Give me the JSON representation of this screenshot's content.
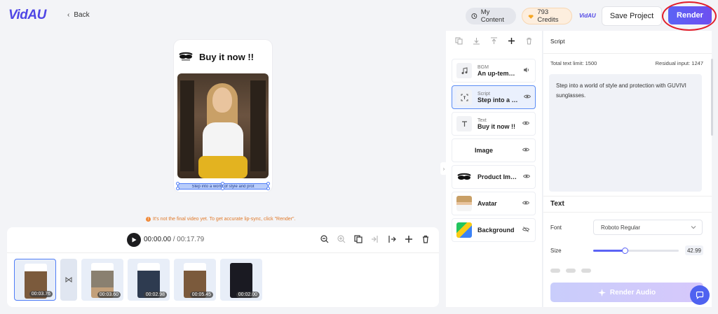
{
  "header": {
    "logo": "VidAU",
    "back_label": "Back",
    "my_content_label": "My Content",
    "credits_label": "793 Credits",
    "brand_small": "VidAU",
    "save_label": "Save Project",
    "render_label": "Render"
  },
  "preview": {
    "title": "Buy it now !!",
    "caption": "Step into a world of style and prot",
    "notice": "It's not the final video yet. To get accurate lip-sync, click \"Render\"."
  },
  "timeline": {
    "current_time": "00:00.00",
    "total_time": "/ 00:17.79",
    "clips": [
      {
        "duration": "00:03.76",
        "selected": true
      },
      {
        "duration": "00:03.60",
        "selected": false
      },
      {
        "duration": "00:02.98",
        "selected": false
      },
      {
        "duration": "00:05.45",
        "selected": false
      },
      {
        "duration": "00:02.00",
        "selected": false
      }
    ]
  },
  "layers": {
    "items": [
      {
        "category": "BGM",
        "value": "An up-tempo ...",
        "icon": "music-icon",
        "control": "volume-icon"
      },
      {
        "category": "Script",
        "value": "Step into a wo...",
        "icon": "script-icon",
        "control": "eye-icon",
        "active": true
      },
      {
        "category": "Text",
        "value": "Buy it now !!",
        "icon": "text-icon",
        "control": "eye-icon"
      },
      {
        "category": "",
        "value": "Image",
        "icon": "image-icon",
        "control": "eye-icon"
      },
      {
        "category": "",
        "value": "Product Image",
        "icon": "product-image-thumb",
        "control": "eye-icon"
      },
      {
        "category": "",
        "value": "Avatar",
        "icon": "avatar-thumb",
        "control": "eye-icon"
      },
      {
        "category": "",
        "value": "Background",
        "icon": "background-thumb",
        "control": "eye-off-icon"
      }
    ]
  },
  "script": {
    "title": "Script",
    "total_limit": "Total text limit: 1500",
    "residual": "Residual input: 1247",
    "text": "Step into a world of style and protection with GUVIVI sunglasses.",
    "text_section": "Text",
    "font_label": "Font",
    "font_value": "Roboto Regular",
    "size_label": "Size",
    "size_value": "42.99",
    "size_fraction": 0.37,
    "render_audio_label": "Render Audio"
  },
  "colors": {
    "accent": "#5b63f5",
    "highlight_ring": "#e11d2a",
    "notice": "#e07a2b"
  }
}
